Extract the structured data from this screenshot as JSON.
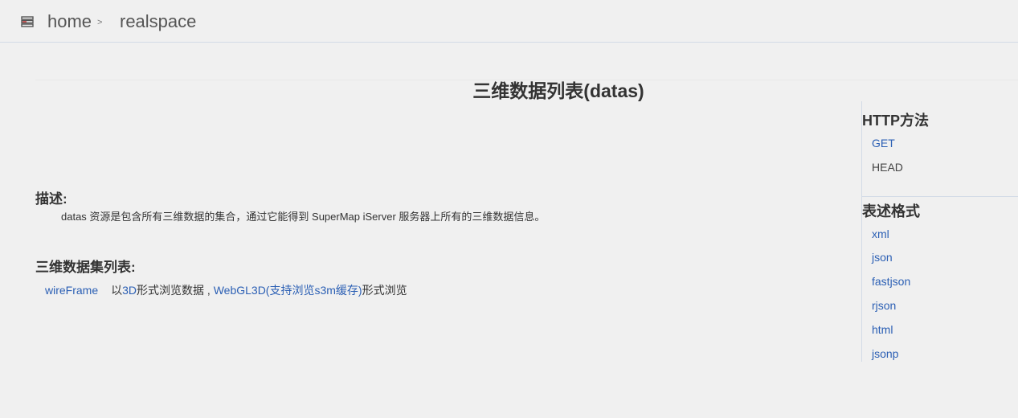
{
  "breadcrumb": {
    "icon": "list-icon",
    "home": "home",
    "separator": ">",
    "current": "realspace"
  },
  "page": {
    "title": "三维数据列表(datas)"
  },
  "description": {
    "heading": "描述:",
    "text": "datas 资源是包含所有三维数据的集合，通过它能得到 SuperMap iServer 服务器上所有的三维数据信息。"
  },
  "dataset_list": {
    "heading": "三维数据集列表:",
    "rows": [
      {
        "name": "wireFrame",
        "text_before": "以",
        "link_3d": "3D",
        "text_middle": "形式浏览数据 , ",
        "link_webgl": "WebGL3D(支持浏览s3m缓存)",
        "text_after": "形式浏览"
      }
    ]
  },
  "sidebar": {
    "http_heading": "HTTP方法",
    "http_methods": [
      "GET",
      "HEAD"
    ],
    "format_heading": "表述格式",
    "formats": [
      "xml",
      "json",
      "fastjson",
      "rjson",
      "html",
      "jsonp"
    ]
  },
  "colors": {
    "background": "#f0f0f0",
    "link": "#2b5fb4",
    "text": "#333333",
    "border": "#d3dbe6"
  }
}
